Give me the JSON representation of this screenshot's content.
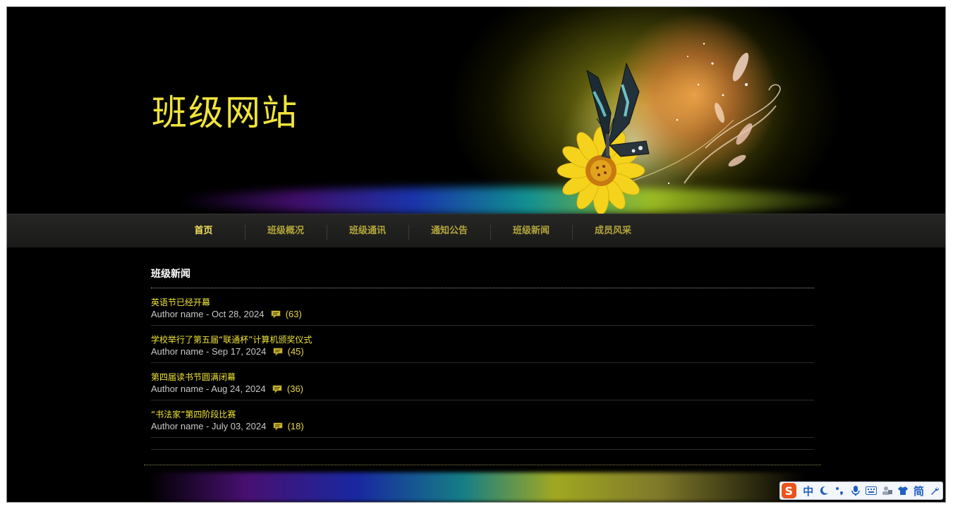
{
  "site": {
    "title": "班级网站"
  },
  "nav": {
    "items": [
      {
        "label": "首页",
        "active": true
      },
      {
        "label": "班级概况",
        "active": false
      },
      {
        "label": "班级通讯",
        "active": false
      },
      {
        "label": "通知公告",
        "active": false
      },
      {
        "label": "班级新闻",
        "active": false
      },
      {
        "label": "成员风采",
        "active": false
      }
    ]
  },
  "news": {
    "heading": "班级新闻",
    "items": [
      {
        "title": "英语节已经开幕",
        "author": "Author name",
        "date": "Oct 28, 2024",
        "comments": "(63)"
      },
      {
        "title": "学校举行了第五届“联通杯”计算机颁奖仪式",
        "author": "Author name",
        "date": "Sep 17, 2024",
        "comments": "(45)"
      },
      {
        "title": "第四届读书节圆满闭幕",
        "author": "Author name",
        "date": "Aug 24, 2024",
        "comments": "(36)"
      },
      {
        "title": "“书法家”第四阶段比赛",
        "author": "Author name",
        "date": "July 03, 2024",
        "comments": "(18)"
      }
    ],
    "separator": " - "
  },
  "ime": {
    "logo": "S",
    "items": [
      {
        "label": "中",
        "icon": "chinese-mode"
      },
      {
        "label": "",
        "icon": "half-moon-width"
      },
      {
        "label": "",
        "icon": "punctuation"
      },
      {
        "label": "",
        "icon": "microphone"
      },
      {
        "label": "",
        "icon": "keyboard"
      },
      {
        "label": "",
        "icon": "user-account"
      },
      {
        "label": "",
        "icon": "skin-shirt"
      },
      {
        "label": "简",
        "icon": "simplified-chinese"
      },
      {
        "label": "",
        "icon": "wrench-settings"
      }
    ]
  },
  "colors": {
    "background": "#000000",
    "title_yellow": "#f0e43a",
    "nav_text": "#b3a53a",
    "nav_active": "#f3e25a",
    "meta_text": "#c8c8c8",
    "ime_blue": "#1f5fbf",
    "ime_logo": "#e8541c"
  }
}
